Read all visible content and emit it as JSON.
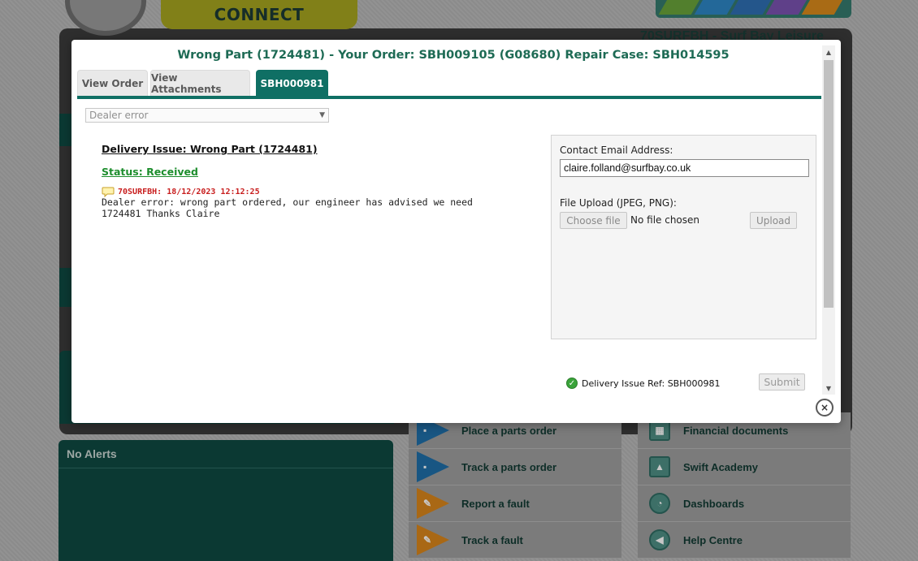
{
  "background": {
    "brand_label": "CONNECT",
    "dealer_title": "70SURFBH - Surf Bay Leisure",
    "alerts_title": "No Alerts",
    "menu_left": [
      {
        "label": "Place a parts order",
        "icon": "truck-icon",
        "color": "#1f6fa8"
      },
      {
        "label": "Track a parts order",
        "icon": "truck-icon",
        "color": "#1f6fa8"
      },
      {
        "label": "Report a fault",
        "icon": "wrench-icon",
        "color": "#d9861c"
      },
      {
        "label": "Track a fault",
        "icon": "wrench-icon",
        "color": "#d9861c"
      }
    ],
    "menu_right": [
      {
        "label": "Financial documents",
        "icon": "calendar-icon"
      },
      {
        "label": "Swift Academy",
        "icon": "academy-icon"
      },
      {
        "label": "Dashboards",
        "icon": "gauge-icon"
      },
      {
        "label": "Help Centre",
        "icon": "megaphone-icon"
      }
    ]
  },
  "modal": {
    "title": "Wrong Part (1724481) - Your Order: SBH009105 (G08680) Repair Case: SBH014595",
    "tabs": [
      {
        "label": "View Order",
        "active": false
      },
      {
        "label": "View Attachments",
        "active": false
      },
      {
        "label": "SBH000981",
        "active": true
      }
    ],
    "reason_select": {
      "value": "Dealer error"
    },
    "issue_heading": "Delivery Issue: Wrong Part (1724481)",
    "status": "Status: Received",
    "comment": {
      "author": "70SURFBH: 18/12/2023 12:12:25",
      "text": "Dealer error: wrong part ordered, our engineer has advised we need 1724481 Thanks Claire"
    },
    "contact": {
      "email_label": "Contact Email Address:",
      "email_value": "claire.folland@surfbay.co.uk"
    },
    "upload": {
      "label": "File Upload (JPEG, PNG):",
      "choose_label": "Choose file",
      "no_file": "No file chosen",
      "upload_label": "Upload"
    },
    "reference": "Delivery Issue Ref: SBH000981",
    "submit_label": "Submit",
    "close_label": "×"
  },
  "colors": {
    "accent": "#0f6f64",
    "title": "#1e6b55",
    "status": "#1e8e2e",
    "comment_author": "#c81e1e"
  }
}
